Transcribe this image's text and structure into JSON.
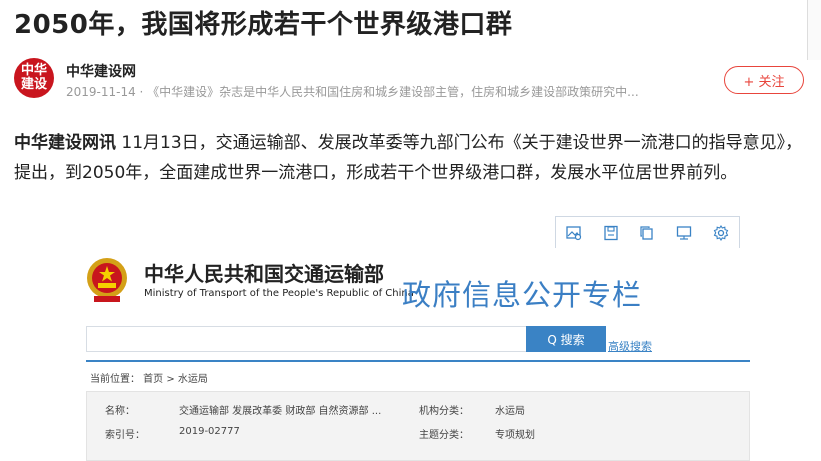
{
  "article": {
    "title": "2050年，我国将形成若干个世界级港口群",
    "author": "中华建设网",
    "meta": "2019-11-14 · 《中华建设》杂志是中华人民共和国住房和城乡建设部主管，住房和城乡建设部政策研究中...",
    "follow_label": "+ 关注",
    "lead": "中华建设网讯",
    "body": " 11月13日，交通运输部、发展改革委等九部门公布《关于建设世界一流港口的指导意见》，提出，到2050年，全面建成世界一流港口，形成若干个世界级港口群，发展水平位居世界前列。"
  },
  "avatar_text": [
    "中华",
    "建设"
  ],
  "toolbar": {
    "icons": [
      "image-search-icon",
      "save-icon",
      "copy-icon",
      "screen-icon",
      "settings-icon"
    ]
  },
  "gov_site": {
    "name_cn": "中华人民共和国交通运输部",
    "name_en": "Ministry of Transport of the People's Republic of China",
    "banner": "政府信息公开专栏",
    "search_label": "Q 搜索",
    "advanced_search": "高级搜索",
    "breadcrumb": "当前位置： 首页 > 水运局",
    "info": {
      "name_label": "名称：",
      "name_value": "交通运输部 发展改革委 财政部 自然资源部 ...",
      "agency_label": "机构分类：",
      "agency_value": "水运局",
      "index_label": "索引号：",
      "index_value": "2019-02777",
      "topic_label": "主题分类：",
      "topic_value": "专项规划"
    }
  },
  "colors": {
    "accent_red": "#e8453c",
    "gov_blue": "#3a83c5",
    "banner_blue": "#3b7fc4"
  }
}
